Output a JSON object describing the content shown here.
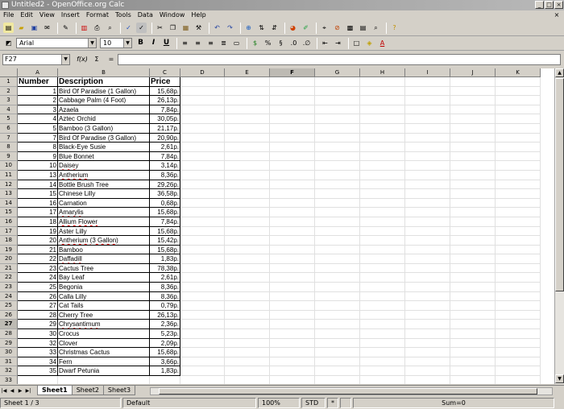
{
  "window": {
    "title": "Untitled2 - OpenOffice.org Calc",
    "min": "_",
    "max": "□",
    "close": "×"
  },
  "menu": [
    "File",
    "Edit",
    "View",
    "Insert",
    "Format",
    "Tools",
    "Data",
    "Window",
    "Help"
  ],
  "toolbar2": {
    "font": "Arial",
    "size": "10",
    "bold": "B",
    "italic": "I",
    "underline": "U"
  },
  "formula": {
    "cell_ref": "F27",
    "fx": "f(x)",
    "sum": "Σ",
    "equals": "=",
    "value": ""
  },
  "columns": [
    "A",
    "B",
    "C",
    "D",
    "E",
    "F",
    "G",
    "H",
    "I",
    "J",
    "K"
  ],
  "active_column": "F",
  "active_row": 27,
  "headers": {
    "a": "Number",
    "b": "Description",
    "c": "Price"
  },
  "rows": [
    {
      "n": "1",
      "d": "Bird Of Paradise (1 Gallon)",
      "p": "15,68р."
    },
    {
      "n": "2",
      "d": "Cabbage Palm (4 Foot)",
      "p": "26,13р."
    },
    {
      "n": "3",
      "d": "Azaela",
      "p": "7,84р."
    },
    {
      "n": "4",
      "d": "Aztec Orchid",
      "p": "30,05р."
    },
    {
      "n": "5",
      "d": "Bamboo (3 Gallon)",
      "p": "21,17р."
    },
    {
      "n": "7",
      "d": "Bird Of Paradise (3 Gallon)",
      "p": "20,90р."
    },
    {
      "n": "8",
      "d": "Black-Eye Susie",
      "p": "2,61р."
    },
    {
      "n": "9",
      "d": "Blue Bonnet",
      "p": "7,84р."
    },
    {
      "n": "10",
      "d": "Daisey",
      "p": "3,14р."
    },
    {
      "n": "13",
      "d": "Antherium",
      "p": "8,36р."
    },
    {
      "n": "14",
      "d": "Bottle Brush Tree",
      "p": "29,26р."
    },
    {
      "n": "15",
      "d": "Chinese Lilly",
      "p": "36,58р."
    },
    {
      "n": "16",
      "d": "Carnation",
      "p": "0,68р."
    },
    {
      "n": "17",
      "d": "Amarylis",
      "p": "15,68р."
    },
    {
      "n": "18",
      "d": "Allium Flower",
      "p": "7,84р."
    },
    {
      "n": "19",
      "d": "Aster Lilly",
      "p": "15,68р."
    },
    {
      "n": "20",
      "d": "Antherium (3 Gallon)",
      "p": "15,42р."
    },
    {
      "n": "21",
      "d": "Bamboo",
      "p": "15,68р."
    },
    {
      "n": "22",
      "d": "Daffadill",
      "p": "1,83р."
    },
    {
      "n": "23",
      "d": "Cactus Tree",
      "p": "78,38р."
    },
    {
      "n": "24",
      "d": "Bay Leaf",
      "p": "2,61р."
    },
    {
      "n": "25",
      "d": "Begonia",
      "p": "8,36р."
    },
    {
      "n": "26",
      "d": "Calla Lilly",
      "p": "8,36р."
    },
    {
      "n": "27",
      "d": "Cat Tails",
      "p": "0,79р."
    },
    {
      "n": "28",
      "d": "Cherry Tree",
      "p": "26,13р."
    },
    {
      "n": "29",
      "d": "Chrysantimum",
      "p": "2,36р."
    },
    {
      "n": "30",
      "d": "Crocus",
      "p": "5,23р."
    },
    {
      "n": "32",
      "d": "Clover",
      "p": "2,09р."
    },
    {
      "n": "33",
      "d": "Christmas Cactus",
      "p": "15,68р."
    },
    {
      "n": "34",
      "d": "Fern",
      "p": "3,66р."
    },
    {
      "n": "35",
      "d": "Dwarf Petunia",
      "p": "1,83р."
    }
  ],
  "misspelled": [
    "Azaela",
    "Daisey",
    "Antherium",
    "Amarylis",
    "Allium Flower",
    "Antherium (3 Gallon)",
    "Daffadill",
    "Chrysantimum"
  ],
  "sheets": [
    "Sheet1",
    "Sheet2",
    "Sheet3"
  ],
  "status": {
    "sheet": "Sheet 1 / 3",
    "style": "Default",
    "zoom": "100%",
    "mode": "STD",
    "modified": "*",
    "sum": "Sum=0"
  }
}
